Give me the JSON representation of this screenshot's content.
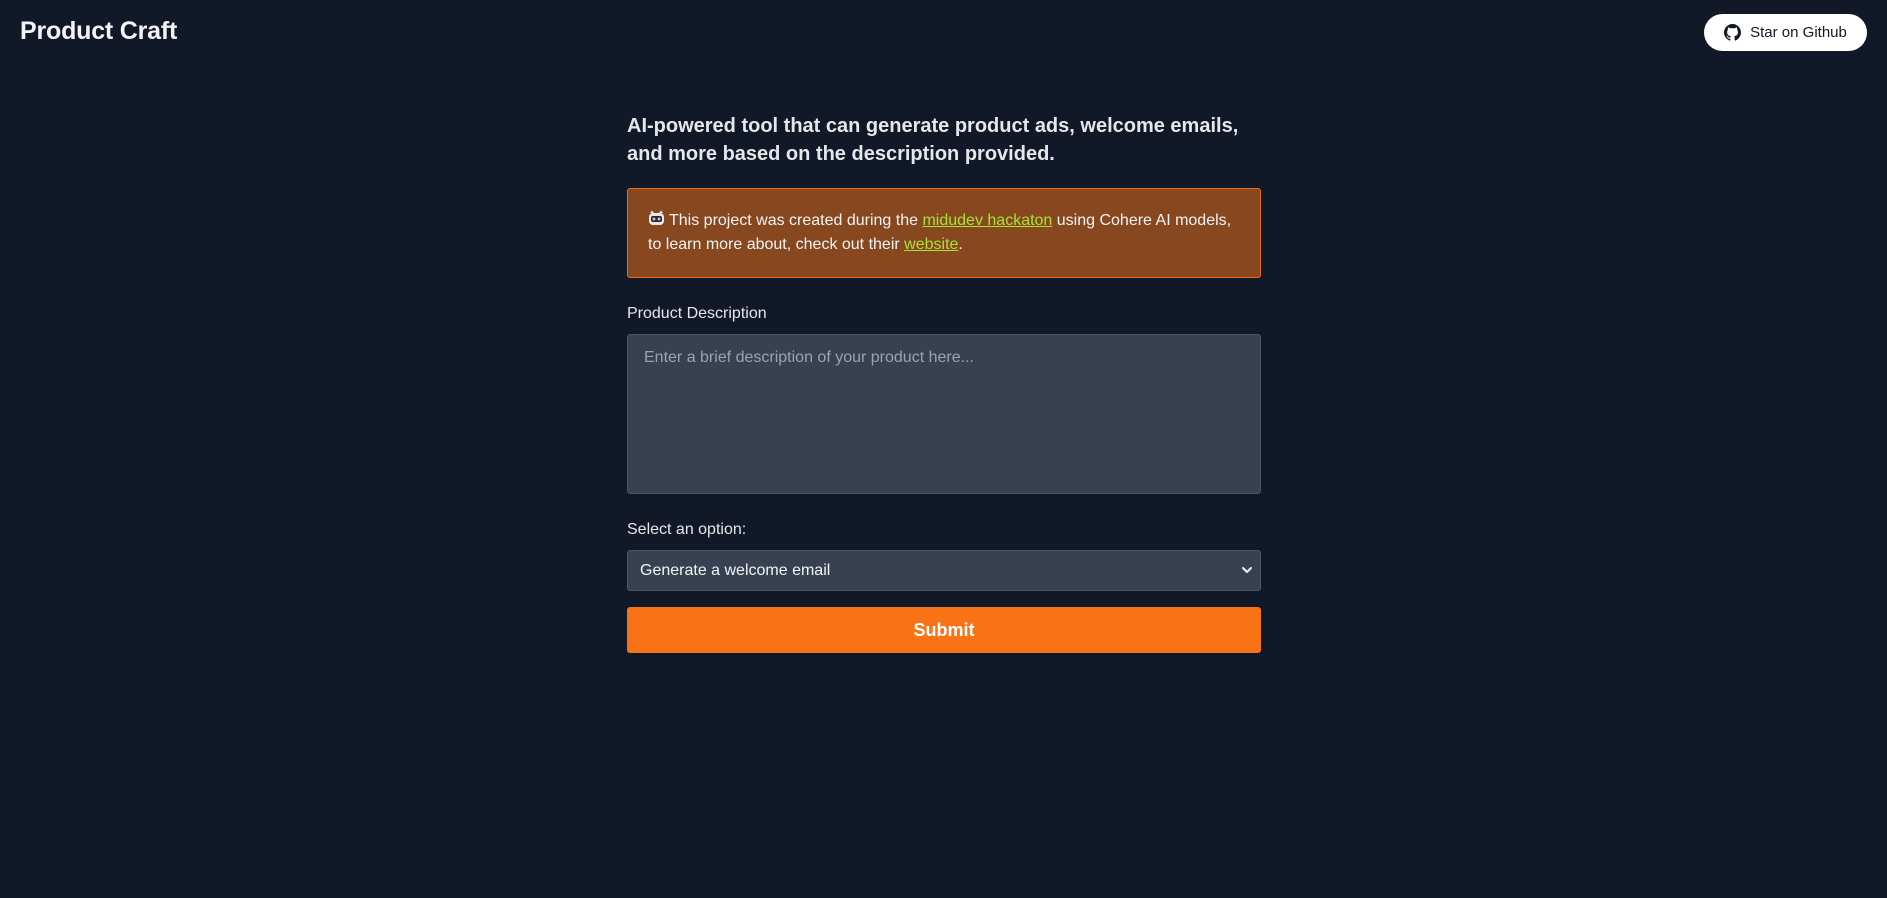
{
  "header": {
    "brand": "Product Craft",
    "github_button": {
      "label": "Star on Github",
      "icon": "github-icon"
    }
  },
  "main": {
    "headline": "AI-powered tool that can generate product ads, welcome emails, and more based on the description provided.",
    "notice": {
      "icon": "robot-emoji-icon",
      "text_before": "This project was created during the",
      "link1": "midudev hackaton",
      "text_middle": "using Cohere AI models, to learn more about, check out their",
      "link2": "website",
      "text_after": "."
    },
    "description": {
      "label": "Product Description",
      "placeholder": "Enter a brief description of your product here...",
      "value": ""
    },
    "option": {
      "label": "Select an option:",
      "selected": "Generate a welcome email"
    },
    "submit_label": "Submit"
  },
  "colors": {
    "background": "#111827",
    "accent": "#f97316",
    "notice_bg": "#87471f",
    "link": "#a3e635"
  }
}
